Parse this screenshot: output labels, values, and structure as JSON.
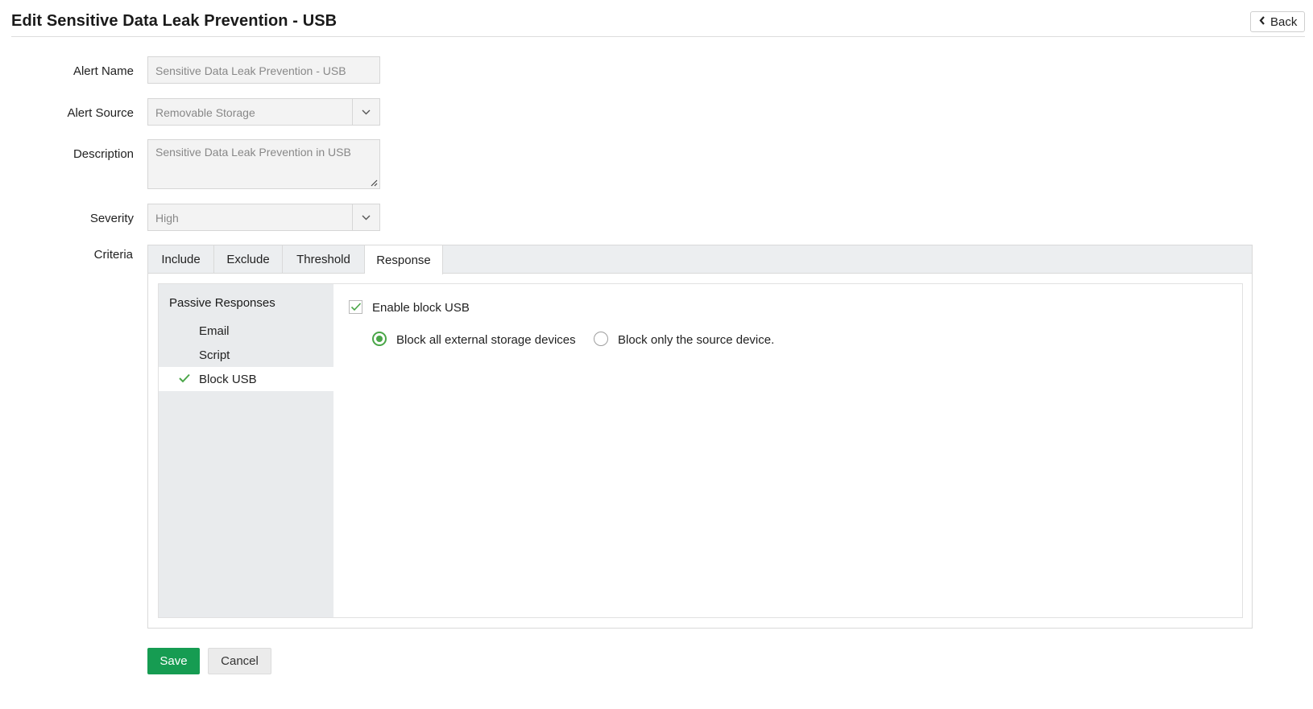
{
  "header": {
    "title": "Edit Sensitive Data Leak Prevention - USB",
    "back_label": "Back"
  },
  "form": {
    "alert_name": {
      "label": "Alert Name",
      "value": "Sensitive Data Leak Prevention - USB"
    },
    "alert_source": {
      "label": "Alert Source",
      "value": "Removable Storage"
    },
    "description": {
      "label": "Description",
      "value": "Sensitive Data Leak Prevention in USB"
    },
    "severity": {
      "label": "Severity",
      "value": "High"
    },
    "criteria_label": "Criteria"
  },
  "criteria": {
    "tabs": [
      {
        "label": "Include"
      },
      {
        "label": "Exclude"
      },
      {
        "label": "Threshold"
      },
      {
        "label": "Response",
        "active": true
      }
    ],
    "passive_responses": {
      "title": "Passive Responses",
      "items": [
        {
          "label": "Email"
        },
        {
          "label": "Script"
        },
        {
          "label": "Block USB",
          "active": true,
          "checked": true
        }
      ]
    },
    "response": {
      "enable_block_usb": {
        "label": "Enable block USB",
        "checked": true
      },
      "options": [
        {
          "label": "Block all external storage devices",
          "selected": true
        },
        {
          "label": "Block only the source device.",
          "selected": false
        }
      ]
    }
  },
  "actions": {
    "save_label": "Save",
    "cancel_label": "Cancel"
  },
  "colors": {
    "accent_green": "#4aa648",
    "save_button": "#169c52"
  }
}
